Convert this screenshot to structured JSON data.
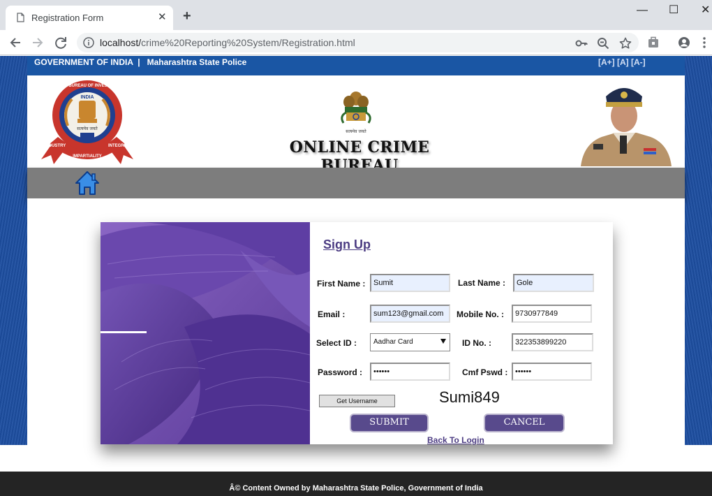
{
  "browser": {
    "tab_title": "Registration Form",
    "tab_close": "✕",
    "new_tab": "+",
    "win_min": "—",
    "win_max": "☐",
    "win_close": "✕",
    "url_host": "localhost/",
    "url_path": "crime%20Reporting%20System/Registration.html"
  },
  "gov_bar": {
    "text": "GOVERNMENT OF INDIA  |   Maharashtra State Police",
    "font_controls": "[A+] [A] [A-]"
  },
  "header": {
    "title": "ONLINE CRIME BUREAU",
    "cbi_top": "CENTRAL BUREAU OF INVESTIGATION",
    "cbi_india": "INDIA",
    "cbi_bottom_left": "INDUSTRY",
    "cbi_bottom_mid": "IMPARTIALITY",
    "cbi_bottom_right": "INTEGRITY",
    "cbi_motto": "सत्यमेव जयते",
    "emblem_motto": "सत्यमेव जयते"
  },
  "form": {
    "heading": "Sign Up",
    "first_name_label": "First Name :",
    "first_name_value": "Sumit",
    "last_name_label": "Last Name :",
    "last_name_value": "Gole",
    "email_label": "Email :",
    "email_value": "sum123@gmail.com",
    "mobile_label": "Mobile No. :",
    "mobile_value": "9730977849",
    "select_id_label": "Select ID :",
    "select_id_value": "Aadhar Card",
    "id_no_label": "ID No. :",
    "id_no_value": "322353899220",
    "password_label": "Password :",
    "password_value": "••••••",
    "confirm_label": "Cmf Pswd :",
    "confirm_value": "••••••",
    "get_username_label": "Get Username",
    "generated_username": "Sumi849",
    "submit_label": "SUBMIT",
    "cancel_label": "CANCEL",
    "back_link": "Back To Login"
  },
  "footer": {
    "text": "Â© Content Owned by Maharashtra State Police, Government of India"
  },
  "colors": {
    "gov_bar": "#1a56a4",
    "page_bg": "#1d4ea0",
    "nav_strip": "#7d7d7d",
    "button": "#584a8c",
    "accent_link": "#4b3b82",
    "footer": "#242424"
  },
  "icons": [
    "document-icon",
    "back-arrow-icon",
    "forward-arrow-icon",
    "reload-icon",
    "info-icon",
    "key-icon",
    "zoom-icon",
    "star-icon",
    "extension-icon",
    "profile-icon",
    "menu-icon",
    "home-icon",
    "dropdown-arrow-icon"
  ]
}
